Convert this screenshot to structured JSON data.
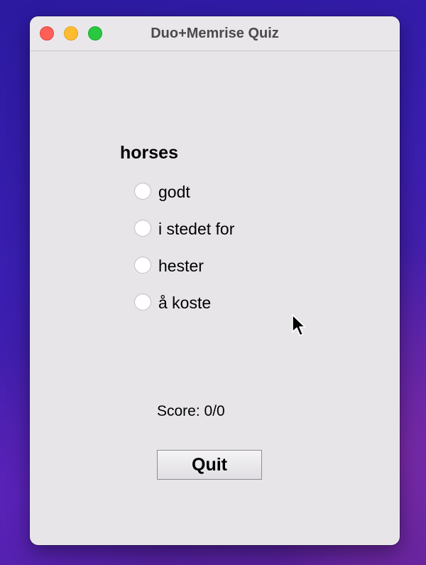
{
  "window": {
    "title": "Duo+Memrise Quiz"
  },
  "quiz": {
    "question": "horses",
    "options": [
      {
        "label": "godt",
        "selected": false
      },
      {
        "label": "i stedet for",
        "selected": false
      },
      {
        "label": "hester",
        "selected": false
      },
      {
        "label": "å koste",
        "selected": false
      }
    ],
    "score": "Score: 0/0",
    "quit_label": "Quit"
  },
  "colors": {
    "close": "#fe5f57",
    "minimize": "#febc2e",
    "zoom": "#28c840",
    "window_bg": "#e7e5e8"
  },
  "icons": [
    "close-icon",
    "minimize-icon",
    "zoom-icon",
    "mouse-pointer-icon"
  ]
}
